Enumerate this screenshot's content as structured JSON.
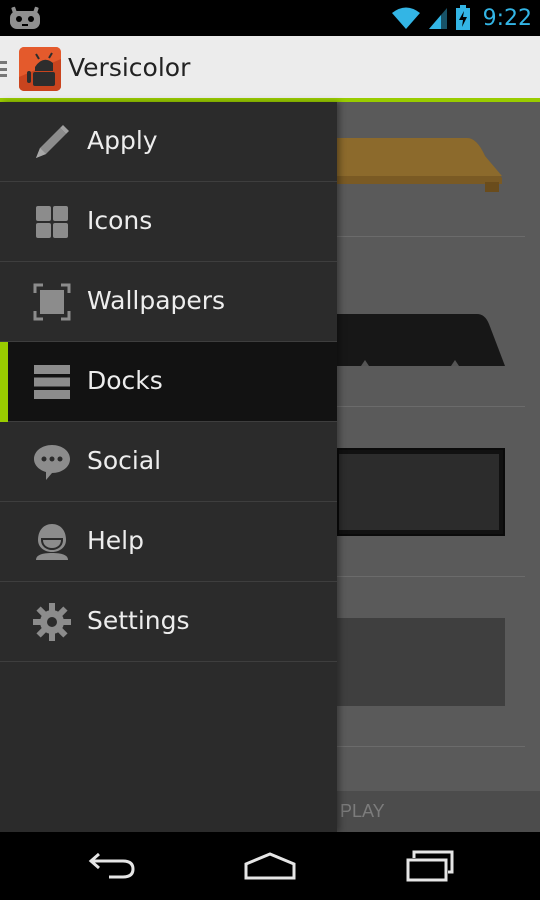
{
  "status_bar": {
    "time": "9:22",
    "left_icon": "cyanogen-mascot-icon",
    "icons": [
      "wifi-icon",
      "signal-icon",
      "battery-charging-icon"
    ],
    "accent_color": "#33b5e5"
  },
  "action_bar": {
    "title": "Versicolor",
    "app_icon": "android-app-icon",
    "accent_color": "#99cc00"
  },
  "drawer": {
    "items": [
      {
        "label": "Apply",
        "icon": "pencil-icon",
        "active": false
      },
      {
        "label": "Icons",
        "icon": "grid-icon",
        "active": false
      },
      {
        "label": "Wallpapers",
        "icon": "picture-frame-icon",
        "active": false
      },
      {
        "label": "Docks",
        "icon": "docks-icon",
        "active": true
      },
      {
        "label": "Social",
        "icon": "chat-bubble-icon",
        "active": false
      },
      {
        "label": "Help",
        "icon": "person-icon",
        "active": false
      },
      {
        "label": "Settings",
        "icon": "gear-icon",
        "active": false
      }
    ]
  },
  "content": {
    "bottom_text": "PLAY"
  },
  "nav_bar": {
    "buttons": [
      "back-icon",
      "home-icon",
      "recent-apps-icon"
    ]
  }
}
